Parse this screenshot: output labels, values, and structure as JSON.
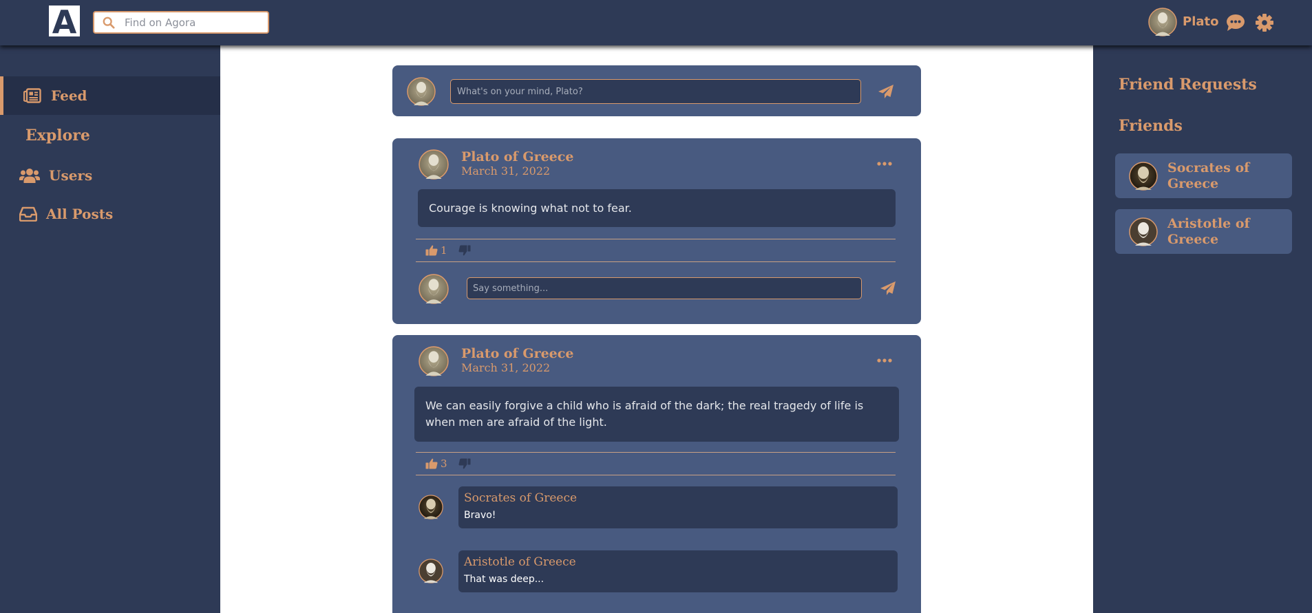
{
  "app": {
    "logo_letter": "A",
    "search_placeholder": "Find on Agora",
    "user_name": "Plato"
  },
  "icons": {
    "search": "search-icon",
    "chat": "comment-dots-icon",
    "settings": "gear-icon",
    "feed": "newspaper-icon",
    "users": "users-icon",
    "all_posts": "inbox-icon",
    "send": "paper-plane-icon",
    "more": "ellipsis-icon",
    "like": "thumbs-up-icon",
    "dislike": "thumbs-down-icon"
  },
  "colors": {
    "header": "#2e3a56",
    "card": "#485a80",
    "accent": "#d99a6c",
    "inner": "#2e3a56"
  },
  "sidebar": {
    "items": [
      {
        "label": "Feed",
        "active": true
      },
      {
        "label": "Explore",
        "active": false
      },
      {
        "label": "Users",
        "active": false
      },
      {
        "label": "All Posts",
        "active": false
      }
    ]
  },
  "composer": {
    "placeholder": "What's on your mind, Plato?"
  },
  "posts": [
    {
      "author": "Plato of Greece",
      "date": "March 31, 2022",
      "body": "Courage is knowing what not to fear.",
      "likes": "1",
      "comment_placeholder": "Say something..."
    },
    {
      "author": "Plato of Greece",
      "date": "March 31, 2022",
      "body": "We can easily forgive a child who is afraid of the dark; the real tragedy of life is when men are afraid of the light.",
      "likes": "3",
      "comments": [
        {
          "author": "Socrates of Greece",
          "text": "Bravo!"
        },
        {
          "author": "Aristotle of Greece",
          "text": "That was deep..."
        }
      ]
    }
  ],
  "right_sidebar": {
    "friend_requests_title": "Friend Requests",
    "friends_title": "Friends",
    "friends": [
      {
        "name": "Socrates of Greece"
      },
      {
        "name": "Aristotle of Greece"
      }
    ]
  }
}
